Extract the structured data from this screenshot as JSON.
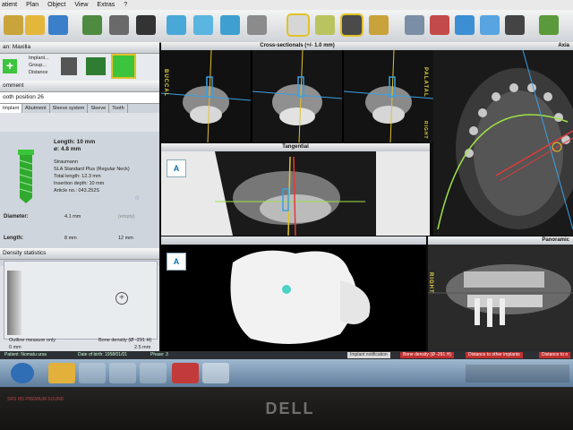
{
  "menu": [
    "atient",
    "Plan",
    "Object",
    "View",
    "Extras"
  ],
  "menu_extras_suffix": "?",
  "left_panel": {
    "plan_header": "an: Maxilla",
    "tree_items": [
      "Implant...",
      "Group...",
      "Distance"
    ],
    "comment_header": "omment",
    "position_header": "ooth position 26",
    "subtabs": [
      "Implant",
      "Abutment",
      "Sleeve system",
      "Sleeve",
      "Tooth"
    ],
    "length_big": "Length: 10 mm",
    "diam_big": "ø: 4.8 mm",
    "manufacturer": "Straumann",
    "product": "SLA Standard Plus (Regular Neck)",
    "total_length": "Total length: 12.3 mm",
    "insertion_depth": "Insertion depth: 10 mm",
    "article_no": "Article no.: 043.252S",
    "diameter_label": "Diameter:",
    "diameter_value": "4.1 mm",
    "diameter_extra": "(empty)",
    "length_label": "Length:",
    "length_value": "8 mm",
    "length_value2": "12 mm",
    "density_header": "Density statistics",
    "outline_label": "Outline measure only",
    "bone_density_label": "Bone density (Ø -291 H)",
    "axis_left": "0 mm",
    "axis_right": "2.5 mm"
  },
  "views": {
    "cross_sectional_title": "Cross-sectionals (+/- 1.0 mm)",
    "buccal": "BUCCAL",
    "palatal": "PALATAL",
    "right": "RIGHT",
    "right2": "RIGHT",
    "tangential_title": "Tangential",
    "axial_title": "Axia",
    "panoramic_title": "Panoramic",
    "badge_a": "A"
  },
  "status": {
    "patient": "Patient: Nomatu ursa",
    "dob": "Date of birth: 1958/01/01",
    "phase": "Phase: 3",
    "implant_notification": "Implant notification",
    "bone_density": "Bone density (Ø -291 H)",
    "distance_other": "Distance to other implants",
    "distance_nerve": "Distance to n"
  },
  "bezel": {
    "brand": "DELL",
    "sticker": "SRS HD PREMIUM SOUND"
  },
  "colors": {
    "implant_green": "#3cc43c",
    "accent_yellow": "#e2c22a",
    "arch_curve": "#9fe24a",
    "nerve_red": "#e23a3a",
    "guide_blue": "#3aa0e2"
  }
}
